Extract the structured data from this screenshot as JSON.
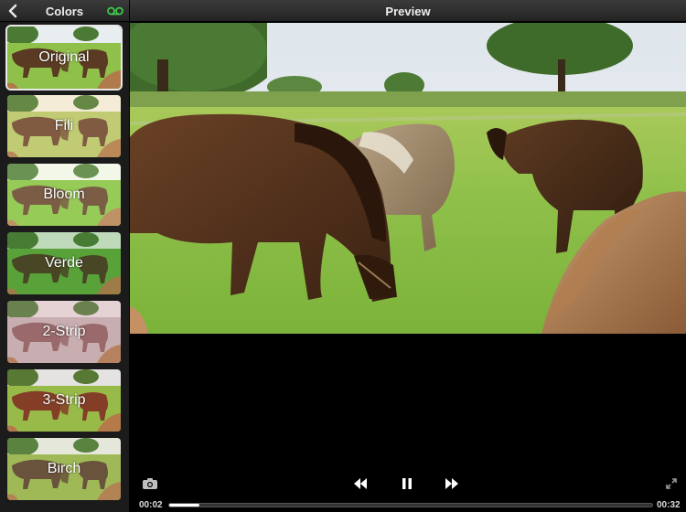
{
  "sidebar": {
    "title": "Colors",
    "back_icon": "chevron-left-icon",
    "loop_icon": "loop-icon",
    "filters": [
      {
        "label": "Original",
        "selected": true,
        "tint": "none"
      },
      {
        "label": "Fili",
        "selected": false,
        "tint": "warm"
      },
      {
        "label": "Bloom",
        "selected": false,
        "tint": "bloom"
      },
      {
        "label": "Verde",
        "selected": false,
        "tint": "green"
      },
      {
        "label": "2-Strip",
        "selected": false,
        "tint": "twostrip"
      },
      {
        "label": "3-Strip",
        "selected": false,
        "tint": "threestrip"
      },
      {
        "label": "Birch",
        "selected": false,
        "tint": "birch"
      }
    ]
  },
  "main": {
    "title": "Preview"
  },
  "player": {
    "current_time": "00:02",
    "total_time": "00:32",
    "progress": 0.0625,
    "icons": {
      "camera": "camera-icon",
      "rewind": "rewind-icon",
      "pause": "pause-icon",
      "forward": "fast-forward-icon",
      "expand": "expand-icon"
    }
  },
  "colors": {
    "header_bg": "#2e2e2e",
    "sidebar_bg": "#1b1b1b",
    "accent_green": "#2ecc40"
  }
}
